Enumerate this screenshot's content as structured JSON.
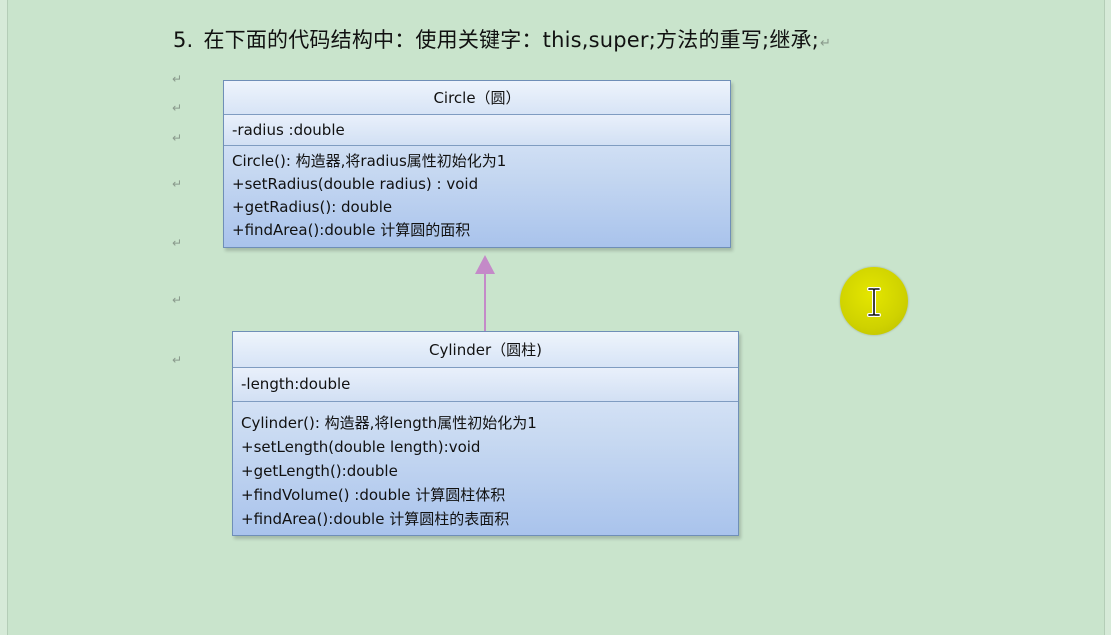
{
  "heading": {
    "number": "5.",
    "text": "在下面的代码结构中：使用关键字：this,super;方法的重写;继承;",
    "paragraph_mark": "↵"
  },
  "paragraph_mark": "↵",
  "classes": {
    "circle": {
      "name": "Circle（圆）",
      "attributes": [
        "-radius :double"
      ],
      "methods": [
        "Circle(): 构造器,将radius属性初始化为1",
        "+setRadius(double radius) : void",
        "+getRadius(): double",
        "+findArea():double  计算圆的面积"
      ]
    },
    "cylinder": {
      "name": "Cylinder（圆柱)",
      "attributes": [
        "-length:double"
      ],
      "methods": [
        "Cylinder():  构造器,将length属性初始化为1",
        "+setLength(double length):void",
        "+getLength():double",
        "+findVolume() :double   计算圆柱体积",
        "+findArea():double  计算圆柱的表面积"
      ]
    }
  },
  "colors": {
    "background": "#c9e4cc",
    "class_fill": "#c6d8f1",
    "class_border": "#6f8fb7",
    "arrow": "#c48ac8",
    "cursor_highlight": "#d4d600"
  },
  "icons": {
    "cursor": "ibeam-cursor-icon",
    "paragraph_mark": "paragraph-return-mark"
  }
}
